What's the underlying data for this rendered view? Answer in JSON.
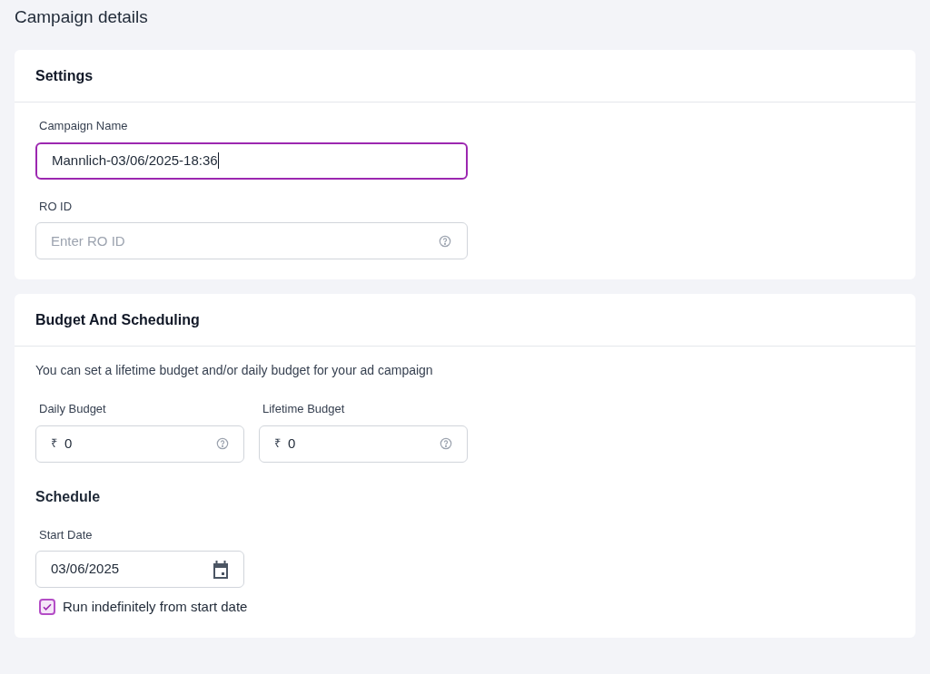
{
  "page_title": "Campaign details",
  "settings": {
    "title": "Settings",
    "campaign_name": {
      "label": "Campaign Name",
      "value": "Mannlich-03/06/2025-18:36",
      "focused": true
    },
    "ro_id": {
      "label": "RO ID",
      "placeholder": "Enter RO ID",
      "focused": false
    }
  },
  "budget": {
    "title": "Budget And Scheduling",
    "description": "You can set a lifetime budget and/or daily budget for your ad campaign",
    "fields": [
      {
        "label": "Daily Budget",
        "currency": "₹",
        "value": "0"
      },
      {
        "label": "Lifetime Budget",
        "currency": "₹",
        "value": "0"
      }
    ],
    "schedule_title": "Schedule",
    "start_date": {
      "label": "Start Date",
      "value": "03/06/2025"
    },
    "run_indefinitely": {
      "label": "Run indefinitely from start date",
      "checked": true
    }
  }
}
